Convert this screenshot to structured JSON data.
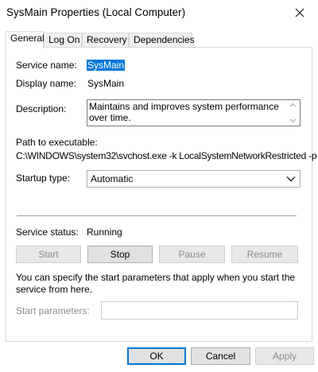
{
  "window": {
    "title": "SysMain Properties (Local Computer)",
    "close_icon": "close-icon"
  },
  "tabs": [
    {
      "label": "General",
      "active": true
    },
    {
      "label": "Log On",
      "active": false
    },
    {
      "label": "Recovery",
      "active": false
    },
    {
      "label": "Dependencies",
      "active": false
    }
  ],
  "general": {
    "service_name_label": "Service name:",
    "service_name_value": "SysMain",
    "display_name_label": "Display name:",
    "display_name_value": "SysMain",
    "description_label": "Description:",
    "description_value": "Maintains and improves system performance over time.",
    "path_label": "Path to executable:",
    "path_value": "C:\\WINDOWS\\system32\\svchost.exe -k LocalSystemNetworkRestricted -p",
    "startup_type_label": "Startup type:",
    "startup_type_value": "Automatic",
    "service_status_label": "Service status:",
    "service_status_value": "Running",
    "buttons": {
      "start": "Start",
      "stop": "Stop",
      "pause": "Pause",
      "resume": "Resume"
    },
    "start_params_note": "You can specify the start parameters that apply when you start the service from here.",
    "start_params_label": "Start parameters:",
    "start_params_value": ""
  },
  "footer": {
    "ok": "OK",
    "cancel": "Cancel",
    "apply": "Apply"
  },
  "colors": {
    "selection": "#0078d7",
    "disabled_text": "#8c8c8c",
    "button_face": "#e1e1e1"
  }
}
